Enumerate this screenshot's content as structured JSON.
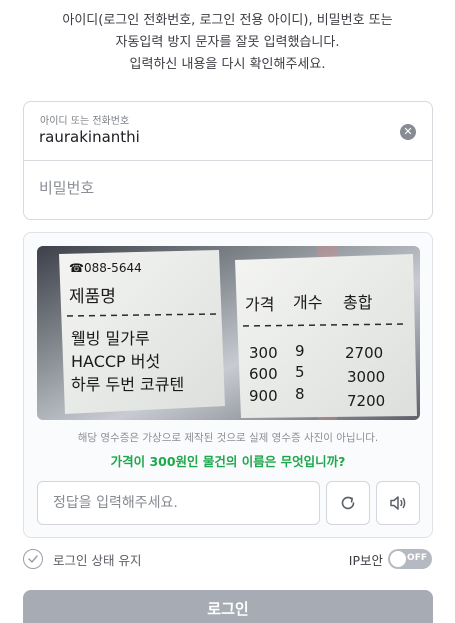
{
  "notice": {
    "line1": "아이디(로그인 전화번호, 로그인 전용 아이디), 비밀번호 또는",
    "line2": "자동입력 방지 문자를 잘못 입력했습니다.",
    "line3": "입력하신 내용을 다시 확인해주세요."
  },
  "login": {
    "id_label": "아이디 또는 전화번호",
    "id_value": "raurakinanthi",
    "password_placeholder": "비밀번호"
  },
  "captcha": {
    "receipt": {
      "phone": "☎088-5644",
      "product_header": "제품명",
      "items": [
        "웰빙 밀가루",
        "HACCP 버섯",
        "하루 두번 코큐텐"
      ],
      "column_headers": [
        "가격",
        "개수",
        "총합"
      ],
      "rows": [
        {
          "price": "300",
          "count": "9",
          "total": "2700"
        },
        {
          "price": "600",
          "count": "5",
          "total": "3000"
        },
        {
          "price": "900",
          "count": "8",
          "total": "7200"
        }
      ]
    },
    "caption": "해당 영수증은 가상으로 제작된 것으로 실제 영수증 사진이 아닙니다.",
    "question": "가격이 300원인 물건의 이름은 무엇입니까?",
    "answer_placeholder": "정답을 입력해주세요."
  },
  "options": {
    "keep_login_label": "로그인 상태 유지",
    "ip_security_label": "IP보안",
    "ip_toggle_state": "OFF"
  },
  "login_button": "로그인",
  "colors": {
    "accent_green": "#1ea74d",
    "button_disabled": "#a6abb4"
  }
}
